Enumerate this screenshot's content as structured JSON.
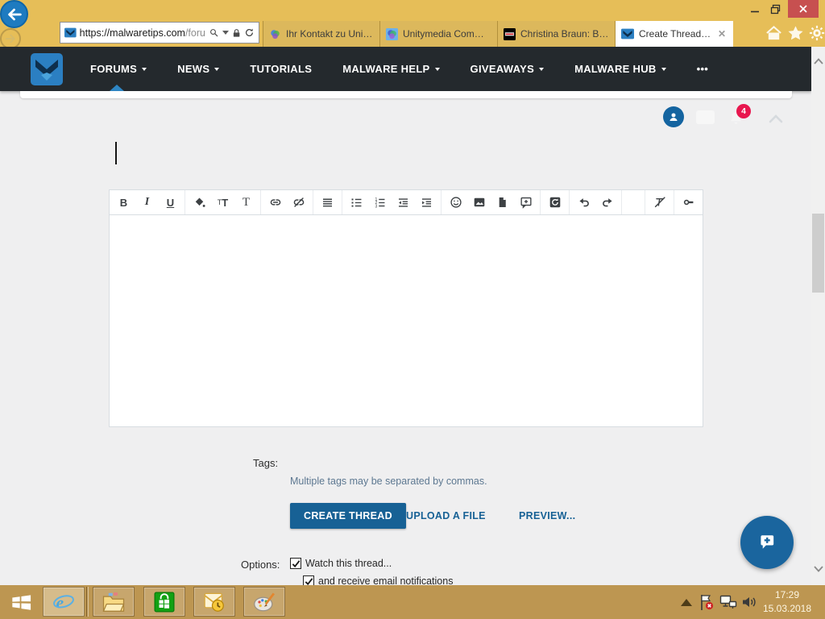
{
  "browser": {
    "url": {
      "host": "https://malwaretips.com",
      "path_hint": "/foru"
    },
    "tabs": [
      {
        "title": "Ihr Kontakt zu Unity...",
        "favicon": "unitymedia-icon",
        "active": false
      },
      {
        "title": "Unitymedia Commu...",
        "favicon": "unitymedia-icon",
        "active": false
      },
      {
        "title": "Christina Braun: Bac...",
        "favicon": "express-icon",
        "active": false
      },
      {
        "title": "Create Thread | ...",
        "favicon": "malwaretips-icon",
        "active": true,
        "close_glyph": "✕"
      }
    ],
    "action_icons": [
      "home-icon",
      "favorites-star-icon",
      "settings-gear-icon"
    ]
  },
  "nav": {
    "items": [
      {
        "label": "FORUMS",
        "caret": true,
        "active": true
      },
      {
        "label": "NEWS",
        "caret": true
      },
      {
        "label": "TUTORIALS",
        "caret": false
      },
      {
        "label": "MALWARE HELP",
        "caret": true
      },
      {
        "label": "GIVEAWAYS",
        "caret": true
      },
      {
        "label": "MALWARE HUB",
        "caret": true
      },
      {
        "label": "•••",
        "caret": false
      }
    ]
  },
  "user_area": {
    "alerts_badge": "4",
    "icons": [
      "avatar-icon",
      "inbox-icon",
      "alerts-bell-icon",
      "collapse-chevron-icon"
    ]
  },
  "editor": {
    "glyphs": {
      "bold": "B",
      "italic": "I",
      "underline": "U",
      "font_size_small": "T",
      "font_size_large": "T",
      "font_family": "T"
    },
    "toolbar_icons": [
      "bold",
      "italic",
      "underline",
      "text-color",
      "font-size",
      "font-family",
      "link",
      "unlink",
      "align-justify",
      "list-bullet",
      "list-ordered",
      "outdent",
      "indent",
      "emoji",
      "image",
      "attach-file",
      "insert-quote",
      "save-draft",
      "undo",
      "redo",
      "remove-format",
      "bbcode-key"
    ]
  },
  "form": {
    "tags_label": "Tags:",
    "tags_help": "Multiple tags may be separated by commas.",
    "create_thread": "CREATE THREAD",
    "upload_file": "UPLOAD A FILE",
    "preview": "PREVIEW...",
    "options_label": "Options:",
    "watch_thread": "Watch this thread...",
    "email_notifications": "and receive email notifications"
  },
  "taskbar": {
    "apps": [
      "start-button",
      "internet-explorer",
      "file-explorer",
      "windows-store",
      "outlook",
      "paint"
    ],
    "tray_icons": [
      "tray-expand-chevron",
      "action-center-flag",
      "network-icon",
      "volume-icon"
    ],
    "clock": {
      "time": "17:29",
      "date": "15.03.2018"
    }
  },
  "colors": {
    "titlebar_gold": "#e6be58",
    "taskbar_gold": "#bd9651",
    "navbar_dark": "#24292d",
    "accent_blue": "#176195",
    "badge_red": "#e8174e",
    "close_red": "#c75050"
  }
}
